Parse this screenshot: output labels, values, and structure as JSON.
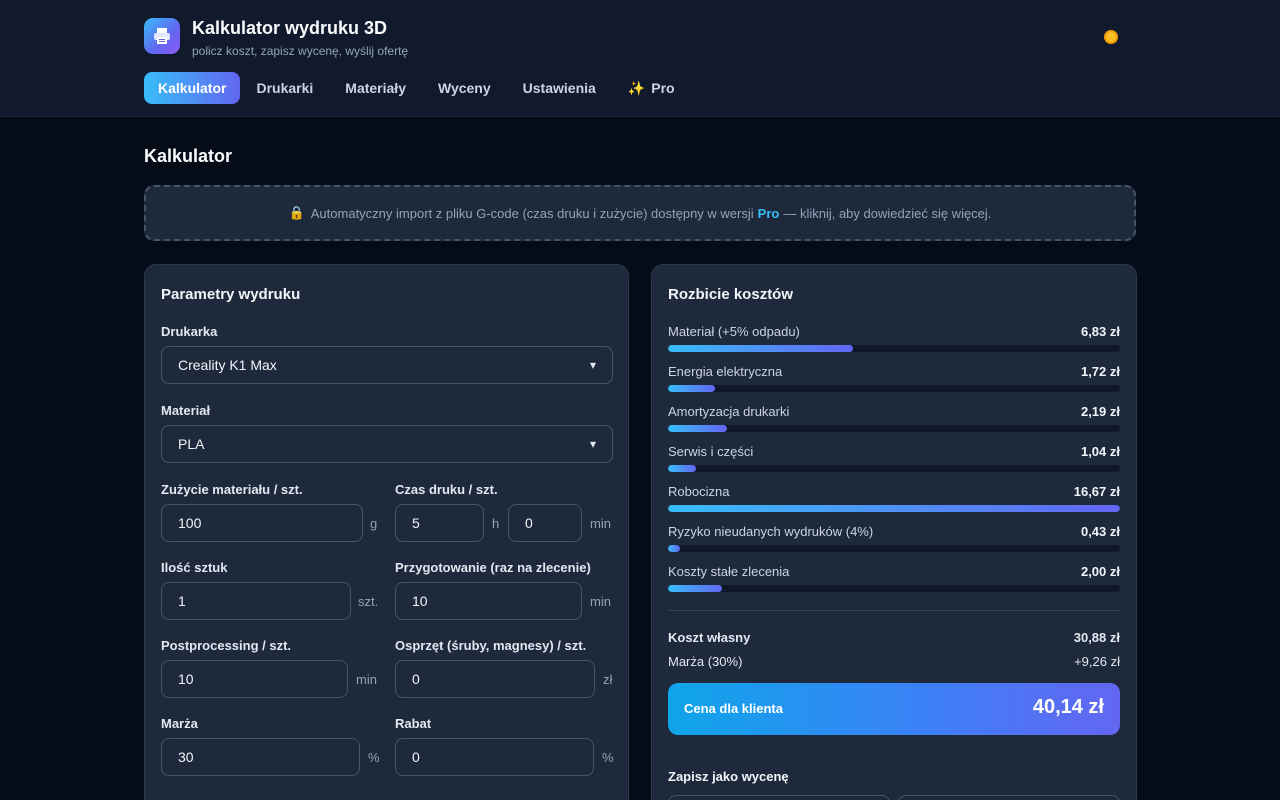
{
  "header": {
    "title": "Kalkulator wydruku 3D",
    "subtitle": "policz koszt, zapisz wycenę, wyślij ofertę",
    "theme_icon": "sun-icon",
    "logo_icon": "printer-icon"
  },
  "nav": {
    "items": [
      {
        "label": "Kalkulator",
        "active": true
      },
      {
        "label": "Drukarki"
      },
      {
        "label": "Materiały"
      },
      {
        "label": "Wyceny"
      },
      {
        "label": "Ustawienia"
      },
      {
        "label": "Pro",
        "icon": "sparkles-icon"
      }
    ]
  },
  "page": {
    "title": "Kalkulator",
    "banner": {
      "before": "Automatyczny import z pliku G-code (czas druku i zużycie) dostępny w wersji",
      "pro": "Pro",
      "after": "— kliknij, aby dowiedzieć się więcej."
    }
  },
  "params": {
    "title": "Parametry wydruku",
    "printer": {
      "label": "Drukarka",
      "value": "Creality K1 Max"
    },
    "material": {
      "label": "Materiał",
      "value": "PLA"
    },
    "usage": {
      "label": "Zużycie materiału / szt.",
      "value": "100",
      "unit": "g"
    },
    "print_time": {
      "label": "Czas druku / szt.",
      "hours": "5",
      "hours_unit": "h",
      "minutes": "0",
      "minutes_unit": "min"
    },
    "qty": {
      "label": "Ilość sztuk",
      "value": "1",
      "unit": "szt."
    },
    "prep": {
      "label": "Przygotowanie (raz na zlecenie)",
      "value": "10",
      "unit": "min"
    },
    "post": {
      "label": "Postprocessing / szt.",
      "value": "10",
      "unit": "min"
    },
    "hardware": {
      "label": "Osprzęt (śruby, magnesy) / szt.",
      "value": "0",
      "unit": "zł"
    },
    "margin": {
      "label": "Marża",
      "value": "30",
      "unit": "%"
    },
    "discount": {
      "label": "Rabat",
      "value": "0",
      "unit": "%"
    }
  },
  "breakdown": {
    "title": "Rozbicie kosztów",
    "items": [
      {
        "name": "Materiał (+5% odpadu)",
        "value": "6,83 zł",
        "share": 0.41
      },
      {
        "name": "Energia elektryczna",
        "value": "1,72 zł",
        "share": 0.103
      },
      {
        "name": "Amortyzacja drukarki",
        "value": "2,19 zł",
        "share": 0.131
      },
      {
        "name": "Serwis i części",
        "value": "1,04 zł",
        "share": 0.062
      },
      {
        "name": "Robocizna",
        "value": "16,67 zł",
        "share": 1.0
      },
      {
        "name": "Ryzyko nieudanych wydruków (4%)",
        "value": "0,43 zł",
        "share": 0.026
      },
      {
        "name": "Koszty stałe zlecenia",
        "value": "2,00 zł",
        "share": 0.12
      }
    ],
    "own_cost_label": "Koszt własny",
    "own_cost_value": "30,88 zł",
    "margin_label": "Marża (30%)",
    "margin_value": "+9,26 zł",
    "price_label": "Cena dla klienta",
    "price_value": "40,14 zł",
    "save_title": "Zapisz jako wycenę"
  }
}
